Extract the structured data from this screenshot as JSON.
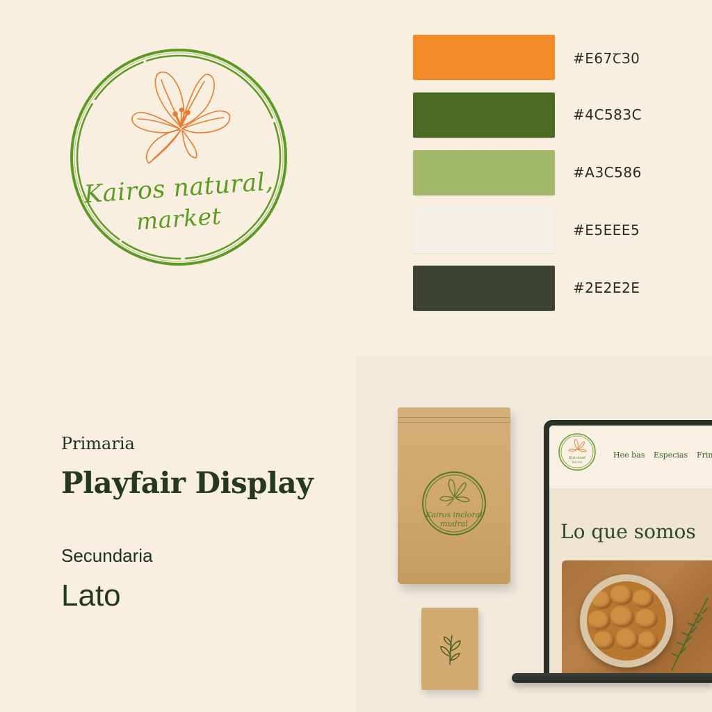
{
  "logo": {
    "line1": "Kairos natural,",
    "line2": "market",
    "ring_color": "#5c9a24",
    "flower_color": "#e67c30",
    "icon": "flower-icon"
  },
  "palette": [
    {
      "color": "#f28a2a",
      "label": "#E67ꞆЗ0"
    },
    {
      "color": "#4c6b22",
      "label": "#4C583C"
    },
    {
      "color": "#a3b86a",
      "label": "#A3C586"
    },
    {
      "color": "#f2f0e8",
      "label": "#E5EEE5"
    },
    {
      "color": "#3c4230",
      "label": "#2E2E2E"
    }
  ],
  "typography": {
    "primary_label": "Primaria",
    "primary_font": "Playfair Display",
    "secondary_label": "Secundaria",
    "secondary_font": "Lato"
  },
  "mockup": {
    "pouch_text_1": "Kairos incloral",
    "pouch_text_2": "mudral",
    "card_icon": "leaf-sprig-icon",
    "site": {
      "logo_text_1": "Kai·rlool",
      "logo_text_2": "ne·ira",
      "nav": [
        "Hee bas",
        "Especias",
        "Frin"
      ],
      "hero_title": "Lo que somos"
    }
  }
}
